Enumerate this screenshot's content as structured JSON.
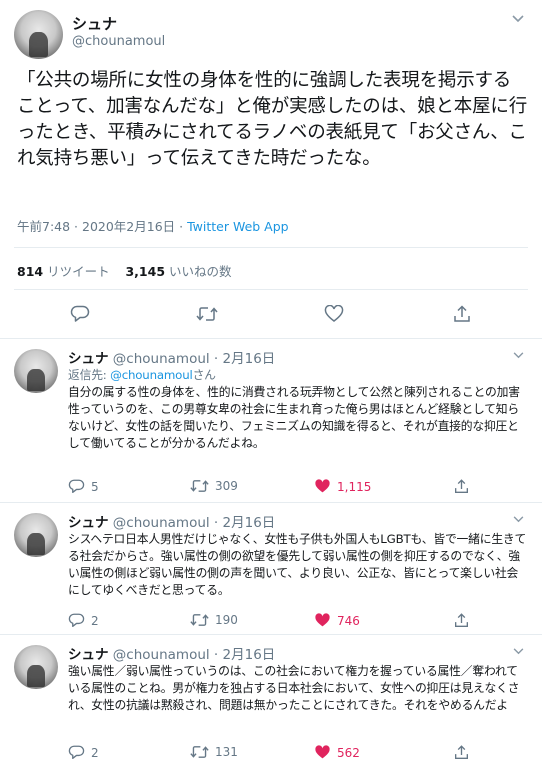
{
  "main": {
    "name": "シュナ",
    "handle": "@chounamoul",
    "text": "「公共の場所に女性の身体を性的に強調した表現を掲示することって、加害なんだな」と俺が実感したのは、娘と本屋に行ったとき、平積みにされてるラノベの表紙見て「お父さん、これ気持ち悪い」って伝えてきた時だったな。",
    "time": "午前7:48 · 2020年2月16日 · ",
    "app": "Twitter Web App",
    "retweets_count": "814",
    "retweets_label": " リツイート",
    "likes_count": "3,145",
    "likes_label": " いいねの数"
  },
  "replies": [
    {
      "name": "シュナ",
      "handle_date": "@chounamoul · 2月16日",
      "replying_prefix": "返信先: ",
      "replying_handle": "@chounamoul",
      "replying_suffix": "さん",
      "text": "自分の属する性の身体を、性的に消費される玩弄物として公然と陳列されることの加害性っていうのを、この男尊女卑の社会に生まれ育った俺ら男はほとんど経験として知らないけど、女性の話を聞いたり、フェミニズムの知識を得ると、それが直接的な抑圧として働いてることが分かるんだよね。",
      "replies": "5",
      "retweets": "309",
      "likes": "1,115"
    },
    {
      "name": "シュナ",
      "handle_date": "@chounamoul · 2月16日",
      "text": "シスヘテロ日本人男性だけじゃなく、女性も子供も外国人もLGBTも、皆で一緒に生きてる社会だからさ。強い属性の側の欲望を優先して弱い属性の側を抑圧するのでなく、強い属性の側ほど弱い属性の側の声を聞いて、より良い、公正な、皆にとって楽しい社会にしてゆくべきだと思ってる。",
      "replies": "2",
      "retweets": "190",
      "likes": "746"
    },
    {
      "name": "シュナ",
      "handle_date": "@chounamoul · 2月16日",
      "text": "強い属性／弱い属性っていうのは、この社会において権力を握っている属性／奪われている属性のことね。男が権力を独占する日本社会において、女性への抑圧は見えなくされ、女性の抗議は黙殺され、問題は無かったことにされてきた。それをやめるんだよ",
      "replies": "2",
      "retweets": "131",
      "likes": "562"
    }
  ],
  "icons": {
    "reply": "reply-icon",
    "retweet": "retweet-icon",
    "like": "heart-icon",
    "share": "share-icon",
    "more": "chevron-down-icon"
  },
  "colors": {
    "link": "#1b95e0",
    "like": "#e0245e",
    "muted": "#657786"
  }
}
